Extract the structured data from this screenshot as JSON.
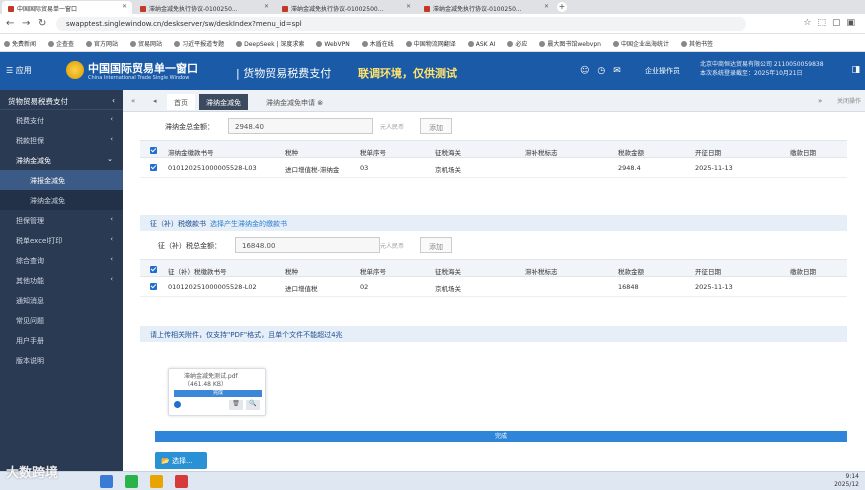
{
  "browser": {
    "tabs": [
      {
        "label": "中国国际贸易单一窗口",
        "active": true
      },
      {
        "label": "滞纳金减免执行协议-0100250..."
      },
      {
        "label": "滞纳金减免执行协议-01002500..."
      },
      {
        "label": "滞纳金减免执行协议-0100250..."
      }
    ],
    "url": "swapptest.singlewindow.cn/deskserver/sw/deskIndex?menu_id=spl",
    "bookmarks": [
      "免费新闻",
      "企查查",
      "官方网站",
      "贸易网站",
      "习近平报道专题",
      "DeepSeek | 深度求索",
      "WebVPN",
      "木盾在线",
      "中国物流网翻译",
      "ASK AI",
      "必应",
      "晨大图书馆webvpn",
      "中国企业出海统计",
      "其他书签"
    ]
  },
  "header": {
    "menu_label": "☰ 应用",
    "title": "中国国际贸易单一窗口",
    "subtitle": "China International Trade Single Window",
    "system": "| 货物贸易税费支付",
    "env_note": "联调环境，仅供测试",
    "operator": "企业操作员",
    "company_line1": "北京中商恒达贸易有限公司 2110050059838",
    "company_line2": "本次系统登录截至：2025年10月21日"
  },
  "sidebar": {
    "head": "货物贸易税费支付",
    "items": [
      {
        "label": "税费支付",
        "arrow": "‹"
      },
      {
        "label": "税款担保",
        "arrow": "‹"
      },
      {
        "label": "滞纳金减免",
        "arrow": "⌄"
      },
      {
        "label": "滞报金减免",
        "arrow": ""
      },
      {
        "label": "滞纳金减免",
        "arrow": ""
      },
      {
        "label": "担保管理",
        "arrow": "‹"
      },
      {
        "label": "税单excel打印",
        "arrow": "‹"
      },
      {
        "label": "综合查询",
        "arrow": "‹"
      },
      {
        "label": "其他功能",
        "arrow": "‹"
      },
      {
        "label": "通知消息",
        "arrow": ""
      },
      {
        "label": "常见问题",
        "arrow": ""
      },
      {
        "label": "用户手册",
        "arrow": ""
      },
      {
        "label": "版本说明",
        "arrow": ""
      }
    ]
  },
  "pagetabs": {
    "prev": "«",
    "back": "◂",
    "home": "首页",
    "mid": "滞纳金减免",
    "current": "滞纳金减免申请 ⊗",
    "next": "»",
    "close": "关闭操作"
  },
  "section1": {
    "amount_label": "滞纳金总金额：",
    "amount_value": "2948.40",
    "unit": "元人民币",
    "add": "添加",
    "headers": [
      "滞纳金缴款书号",
      "税种",
      "税单序号",
      "征税海关",
      "滞补税标志",
      "税款金额",
      "开征日期",
      "缴款日期"
    ],
    "row": [
      "010120251000005528-L03",
      "进口增值税-滞纳金",
      "03",
      "京机场关",
      "",
      "2948.4",
      "2025-11-13",
      ""
    ]
  },
  "section2": {
    "title": "征（补）税缴款书",
    "hint": "选择产生滞纳金的缴款书",
    "amount_label": "征（补）税总金额：",
    "amount_value": "16848.00",
    "unit": "元人民币",
    "add": "添加",
    "headers": [
      "征（补）税缴款书号",
      "税种",
      "税单序号",
      "征税海关",
      "滞补税标志",
      "税款金额",
      "开征日期",
      "缴款日期"
    ],
    "row": [
      "010120251000005528-L02",
      "进口增值税",
      "02",
      "京机场关",
      "",
      "16848",
      "2025-11-13",
      ""
    ]
  },
  "upload": {
    "title": "请上传相关附件，仅支持\"PDF\"格式，且单个文件不能超过4兆",
    "file_name": "滞纳金减免测试.pdf",
    "file_size": "（461.48 KB）",
    "progress_label": "完成",
    "progress_pct": 100,
    "done": "完成",
    "select": "📂 选择..."
  },
  "taskbar": {
    "time": "9:14",
    "date": "2025/12"
  },
  "watermark": "大数跨境",
  "colors": {
    "brand": "#1a5aa6",
    "sidebar": "#2a3a53",
    "accent": "#2f86d8"
  }
}
